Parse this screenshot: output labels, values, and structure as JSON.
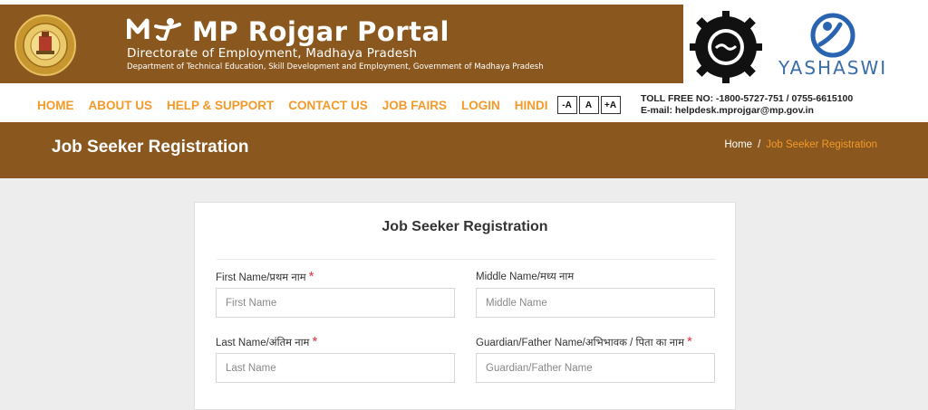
{
  "header": {
    "title": "MP Rojgar Portal",
    "subtitle": "Directorate of Employment, Madhaya Pradesh",
    "department": "Department of Technical Education, Skill Development and Employment, Government of Madhaya Pradesh",
    "yashaswi": "YASHASWI",
    "colors": {
      "brown": "#8a581e",
      "orange": "#f39a2a"
    },
    "icons": [
      "state-emblem-icon",
      "my-logo-icon",
      "employment-exchange-logo-icon",
      "yashaswi-logo-icon"
    ]
  },
  "nav": {
    "items": [
      "HOME",
      "ABOUT US",
      "HELP & SUPPORT",
      "CONTACT US",
      "JOB FAIRS",
      "LOGIN",
      "HINDI"
    ],
    "font_buttons": [
      "-A",
      "A",
      "+A"
    ],
    "toll_free": "TOLL FREE NO: -1800-5727-751 / 0755-6615100",
    "email": "E-mail: helpdesk.mprojgar@mp.gov.in"
  },
  "banner": {
    "title": "Job Seeker Registration",
    "breadcrumb": {
      "home": "Home",
      "separator": "/",
      "current": "Job Seeker Registration"
    }
  },
  "form": {
    "title": "Job Seeker Registration",
    "required_mark": "*",
    "fields": {
      "first_name": {
        "label": "First Name/प्रथम नाम",
        "placeholder": "First Name",
        "value": "",
        "required": true
      },
      "middle_name": {
        "label": "Middle Name/मध्य नाम",
        "placeholder": "Middle Name",
        "value": "",
        "required": false
      },
      "last_name": {
        "label": "Last Name/अंतिम नाम",
        "placeholder": "Last Name",
        "value": "",
        "required": true
      },
      "guardian_name": {
        "label": "Guardian/Father Name/अभिभावक / पिता का नाम",
        "placeholder": "Guardian/Father Name",
        "value": "",
        "required": true
      }
    }
  }
}
